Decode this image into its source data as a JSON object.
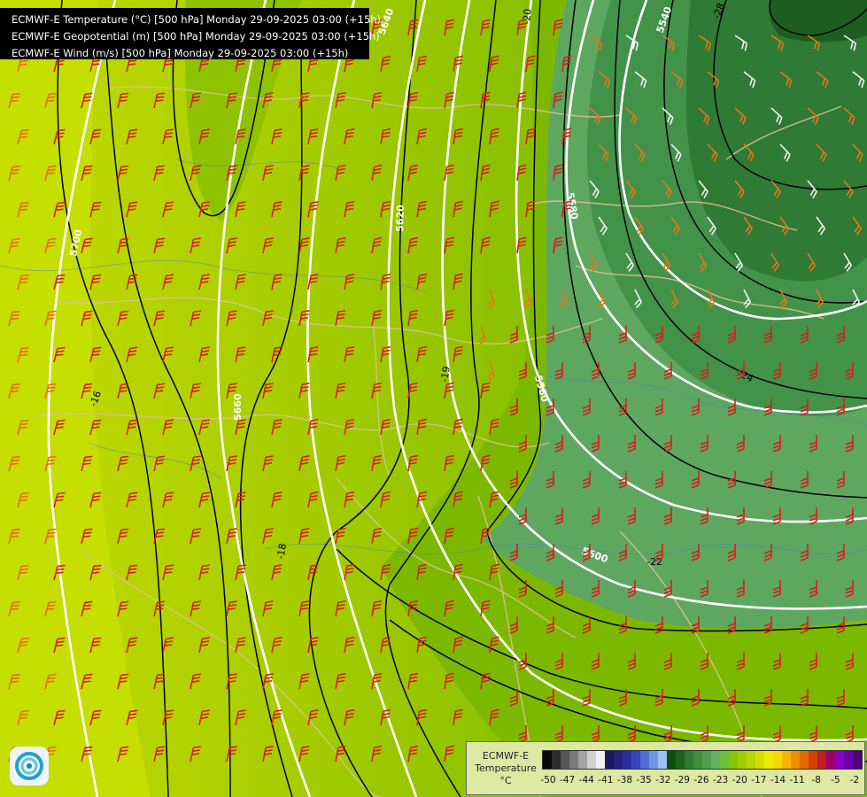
{
  "header": {
    "lines": [
      "ECMWF-E Temperature (°C) [500 hPa] Monday 29-09-2025 03:00 (+15h)",
      "ECMWF-E Geopotential (m) [500 hPa] Monday 29-09-2025 03:00 (+15h)",
      "ECMWF-E Wind (m/s) [500 hPa] Monday 29-09-2025 03:00 (+15h)"
    ]
  },
  "legend": {
    "model": "ECMWF-E",
    "variable": "Temperature",
    "unit": "°C",
    "ticks": [
      "-50",
      "-47",
      "-44",
      "-41",
      "-38",
      "-35",
      "-32",
      "-29",
      "-26",
      "-23",
      "-20",
      "-17",
      "-14",
      "-11",
      "-8",
      "-5",
      "-2"
    ],
    "colors": [
      "#0a0a0a",
      "#2e2e2e",
      "#555555",
      "#7b7b7b",
      "#a3a3a3",
      "#d0d0d0",
      "#f2f2f2",
      "#1a1a5c",
      "#23237e",
      "#2c2ca0",
      "#3a46bd",
      "#4e6fd0",
      "#6f98e0",
      "#9bc2ee",
      "#0e4d0e",
      "#1d621d",
      "#2f7a2f",
      "#3f8f3f",
      "#4f9f4f",
      "#62b062",
      "#6fbf3a",
      "#88c500",
      "#a2cc00",
      "#bcd400",
      "#d5de00",
      "#ecec00",
      "#f7d800",
      "#f4b400",
      "#ee8f00",
      "#e26a00",
      "#d24200",
      "#bf1f1f",
      "#a0006a",
      "#8a00c8",
      "#6b00a8",
      "#4d007a"
    ]
  },
  "isoheights": [
    "5700",
    "5660",
    "5620",
    "5580",
    "5560",
    "5540",
    "5600",
    "5640"
  ],
  "isotherms": [
    "-16",
    "-17",
    "-18",
    "-19",
    "-20",
    "-21",
    "-22",
    "-24",
    "-28"
  ],
  "logo_icon": "ecmwf-swirl-icon"
}
